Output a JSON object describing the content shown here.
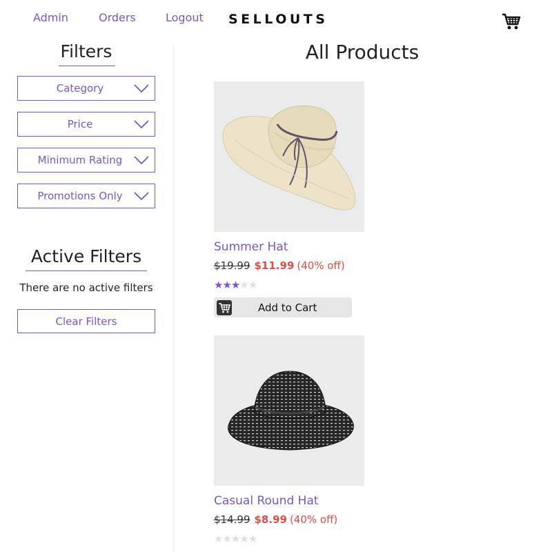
{
  "nav": {
    "links": [
      "Admin",
      "Orders",
      "Logout"
    ],
    "brand": "SELLOUTS",
    "cart_icon": "shopping-cart-icon"
  },
  "sidebar": {
    "filters_title": "Filters",
    "dropdowns": [
      "Category",
      "Price",
      "Minimum Rating",
      "Promotions Only"
    ],
    "active_title": "Active Filters",
    "no_active": "There are no active filters",
    "clear_label": "Clear Filters"
  },
  "main": {
    "title": "All Products",
    "products": [
      {
        "name": "Summer Hat",
        "old_price": "$19.99",
        "new_price": "$11.99",
        "discount": "(40% off)",
        "rating": 3,
        "max_rating": 5,
        "add_label": "Add to Cart"
      },
      {
        "name": "Casual Round Hat",
        "old_price": "$14.99",
        "new_price": "$8.99",
        "discount": "(40% off)",
        "rating": 0,
        "max_rating": 5
      }
    ]
  },
  "colors": {
    "accent": "#7657c9",
    "sale": "#e04b43",
    "image_bg": "#ebebeb"
  }
}
